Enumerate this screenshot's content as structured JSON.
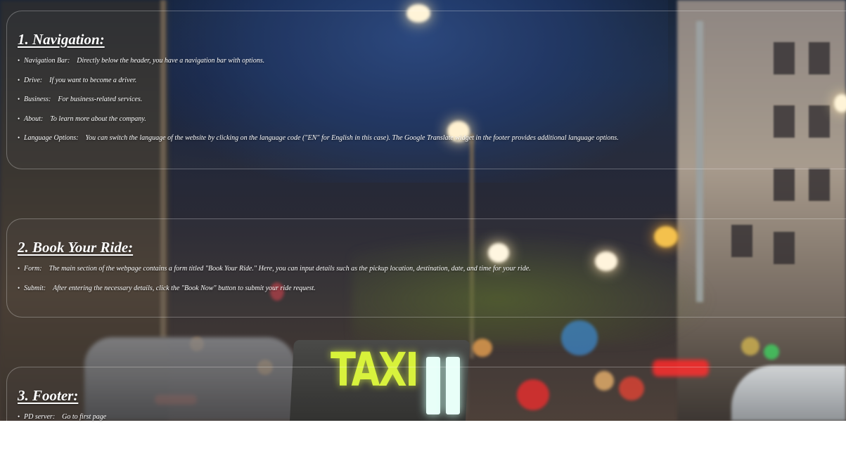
{
  "sections": [
    {
      "heading": "1. Navigation:",
      "items": [
        {
          "term": "Navigation Bar:",
          "text": "Directly below the header, you have a navigation bar with options."
        },
        {
          "term": "Drive:",
          "text": "If you want to become a driver."
        },
        {
          "term": "Business:",
          "text": "For business-related services."
        },
        {
          "term": "About:",
          "text": "To learn more about the company."
        },
        {
          "term": "Language Options:",
          "text": "You can switch the language of the website by clicking on the language code (\"EN\" for English in this case). The Google Translate widget in the footer provides additional language options."
        }
      ]
    },
    {
      "heading": "2. Book Your Ride:",
      "items": [
        {
          "term": "Form:",
          "text": "The main section of the webpage contains a form titled \"Book Your Ride.\" Here, you can input details such as the pickup location, destination, date, and time for your ride."
        },
        {
          "term": "Submit:",
          "text": "After entering the necessary details, click the \"Book Now\" button to submit your ride request."
        }
      ]
    },
    {
      "heading": "3. Footer:",
      "items": [
        {
          "term": "PD server:",
          "text": "Go to first page"
        }
      ]
    }
  ],
  "background": {
    "sign_text": "TAXI",
    "sign_color": "#d8f23a"
  }
}
